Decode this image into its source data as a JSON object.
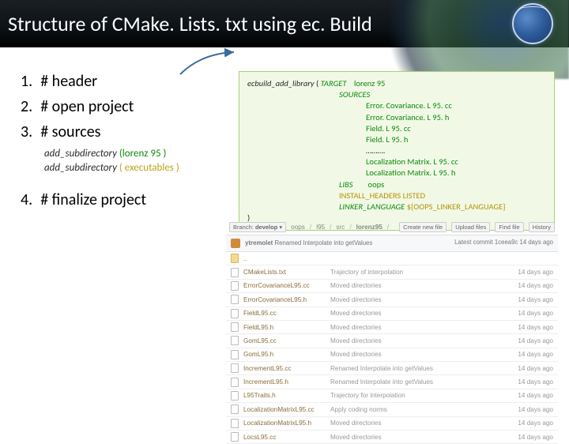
{
  "title": "Structure of CMake. Lists. txt using ec. Build",
  "items": {
    "a": "# header",
    "b": "# open project",
    "c": "# sources",
    "d": "# finalize project"
  },
  "subcode": {
    "fn": "add_subdirectory",
    "line1_arg": "(lorenz 95 )",
    "line2_arg": "( executables )"
  },
  "codebox": {
    "fn": "ecbuild_add_library",
    "open": "(",
    "kw_target": "TARGET",
    "val_target": "lorenz 95",
    "kw_sources": "SOURCES",
    "srcs": [
      "Error. Covariance. L 95. cc",
      "Error. Covariance. L 95. h",
      "Field. L 95. cc",
      "Field. L 95. h",
      "……….",
      "Localization Matrix. L 95. cc",
      "Localization Matrix. L 95. h"
    ],
    "kw_libs": "LIBS",
    "val_libs": "oops",
    "line_install": "INSTALL_HEADERS LISTED",
    "kw_linker": "LINKER_LANGUAGE",
    "val_linker": "${OOPS_LINKER_LANGUAGE}",
    "close": ")"
  },
  "filelist": {
    "breadcrumb": {
      "branch": "develop",
      "p1": "oops",
      "p2": "l95",
      "p3": "src",
      "p4": "lorenz95"
    },
    "head_buttons": [
      "Create new file",
      "Upload files",
      "Find file",
      "History"
    ],
    "commit": {
      "user": "ytremolet",
      "msg": "Renamed Interpolate into getValues",
      "meta": "Latest commit 1ceea9c  14 days ago"
    },
    "rows": [
      {
        "icon": "folder",
        "name": "..",
        "msg": "",
        "time": ""
      },
      {
        "icon": "file",
        "name": "CMakeLists.txt",
        "msg": "Trajectory of interpolation",
        "time": "14 days ago"
      },
      {
        "icon": "file",
        "name": "ErrorCovarianceL95.cc",
        "msg": "Moved directories",
        "time": "14 days ago"
      },
      {
        "icon": "file",
        "name": "ErrorCovarianceL95.h",
        "msg": "Moved directories",
        "time": "14 days ago"
      },
      {
        "icon": "file",
        "name": "FieldL95.cc",
        "msg": "Moved directories",
        "time": "14 days ago"
      },
      {
        "icon": "file",
        "name": "FieldL95.h",
        "msg": "Moved directories",
        "time": "14 days ago"
      },
      {
        "icon": "file",
        "name": "GomL95.cc",
        "msg": "Moved directories",
        "time": "14 days ago"
      },
      {
        "icon": "file",
        "name": "GomL95.h",
        "msg": "Moved directories",
        "time": "14 days ago"
      },
      {
        "icon": "file",
        "name": "IncrementL95.cc",
        "msg": "Renamed Interpolate into getValues",
        "time": "14 days ago"
      },
      {
        "icon": "file",
        "name": "IncrementL95.h",
        "msg": "Renamed Interpolate into getValues",
        "time": "14 days ago"
      },
      {
        "icon": "file",
        "name": "L95Traits.h",
        "msg": "Trajectory for interpolation",
        "time": "14 days ago"
      },
      {
        "icon": "file",
        "name": "LocalizationMatrixL95.cc",
        "msg": "Apply coding norms",
        "time": "14 days ago"
      },
      {
        "icon": "file",
        "name": "LocalizationMatrixL95.h",
        "msg": "Moved directories",
        "time": "14 days ago"
      },
      {
        "icon": "file",
        "name": "LocsL95.cc",
        "msg": "Moved directories",
        "time": "14 days ago"
      }
    ]
  }
}
